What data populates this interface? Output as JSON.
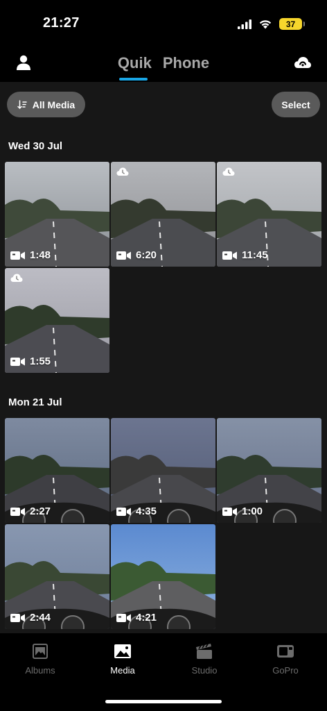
{
  "status": {
    "time": "21:27",
    "battery": "37"
  },
  "header": {
    "tabs": [
      "Quik",
      "Phone"
    ],
    "active_tab": "Phone"
  },
  "toolbar": {
    "filter_label": "All Media",
    "select_label": "Select"
  },
  "sections": [
    {
      "date": "Wed 30 Jul",
      "items": [
        {
          "duration": "1:48",
          "cloud": false
        },
        {
          "duration": "6:20",
          "cloud": true
        },
        {
          "duration": "11:45",
          "cloud": true
        },
        {
          "duration": "1:55",
          "cloud": true
        }
      ]
    },
    {
      "date": "Mon 21 Jul",
      "items": [
        {
          "duration": "2:27",
          "cloud": false
        },
        {
          "duration": "4:35",
          "cloud": false
        },
        {
          "duration": "1:00",
          "cloud": false
        },
        {
          "duration": "2:44",
          "cloud": false
        },
        {
          "duration": "4:21",
          "cloud": false
        }
      ]
    }
  ],
  "bottom_nav": [
    {
      "label": "Albums",
      "icon": "albums-icon",
      "active": false
    },
    {
      "label": "Media",
      "icon": "media-icon",
      "active": true
    },
    {
      "label": "Studio",
      "icon": "clapperboard-icon",
      "active": false
    },
    {
      "label": "GoPro",
      "icon": "gopro-camera-icon",
      "active": false
    }
  ],
  "colors": {
    "accent": "#19a6e6",
    "battery": "#f7d62c",
    "background": "#171717"
  }
}
